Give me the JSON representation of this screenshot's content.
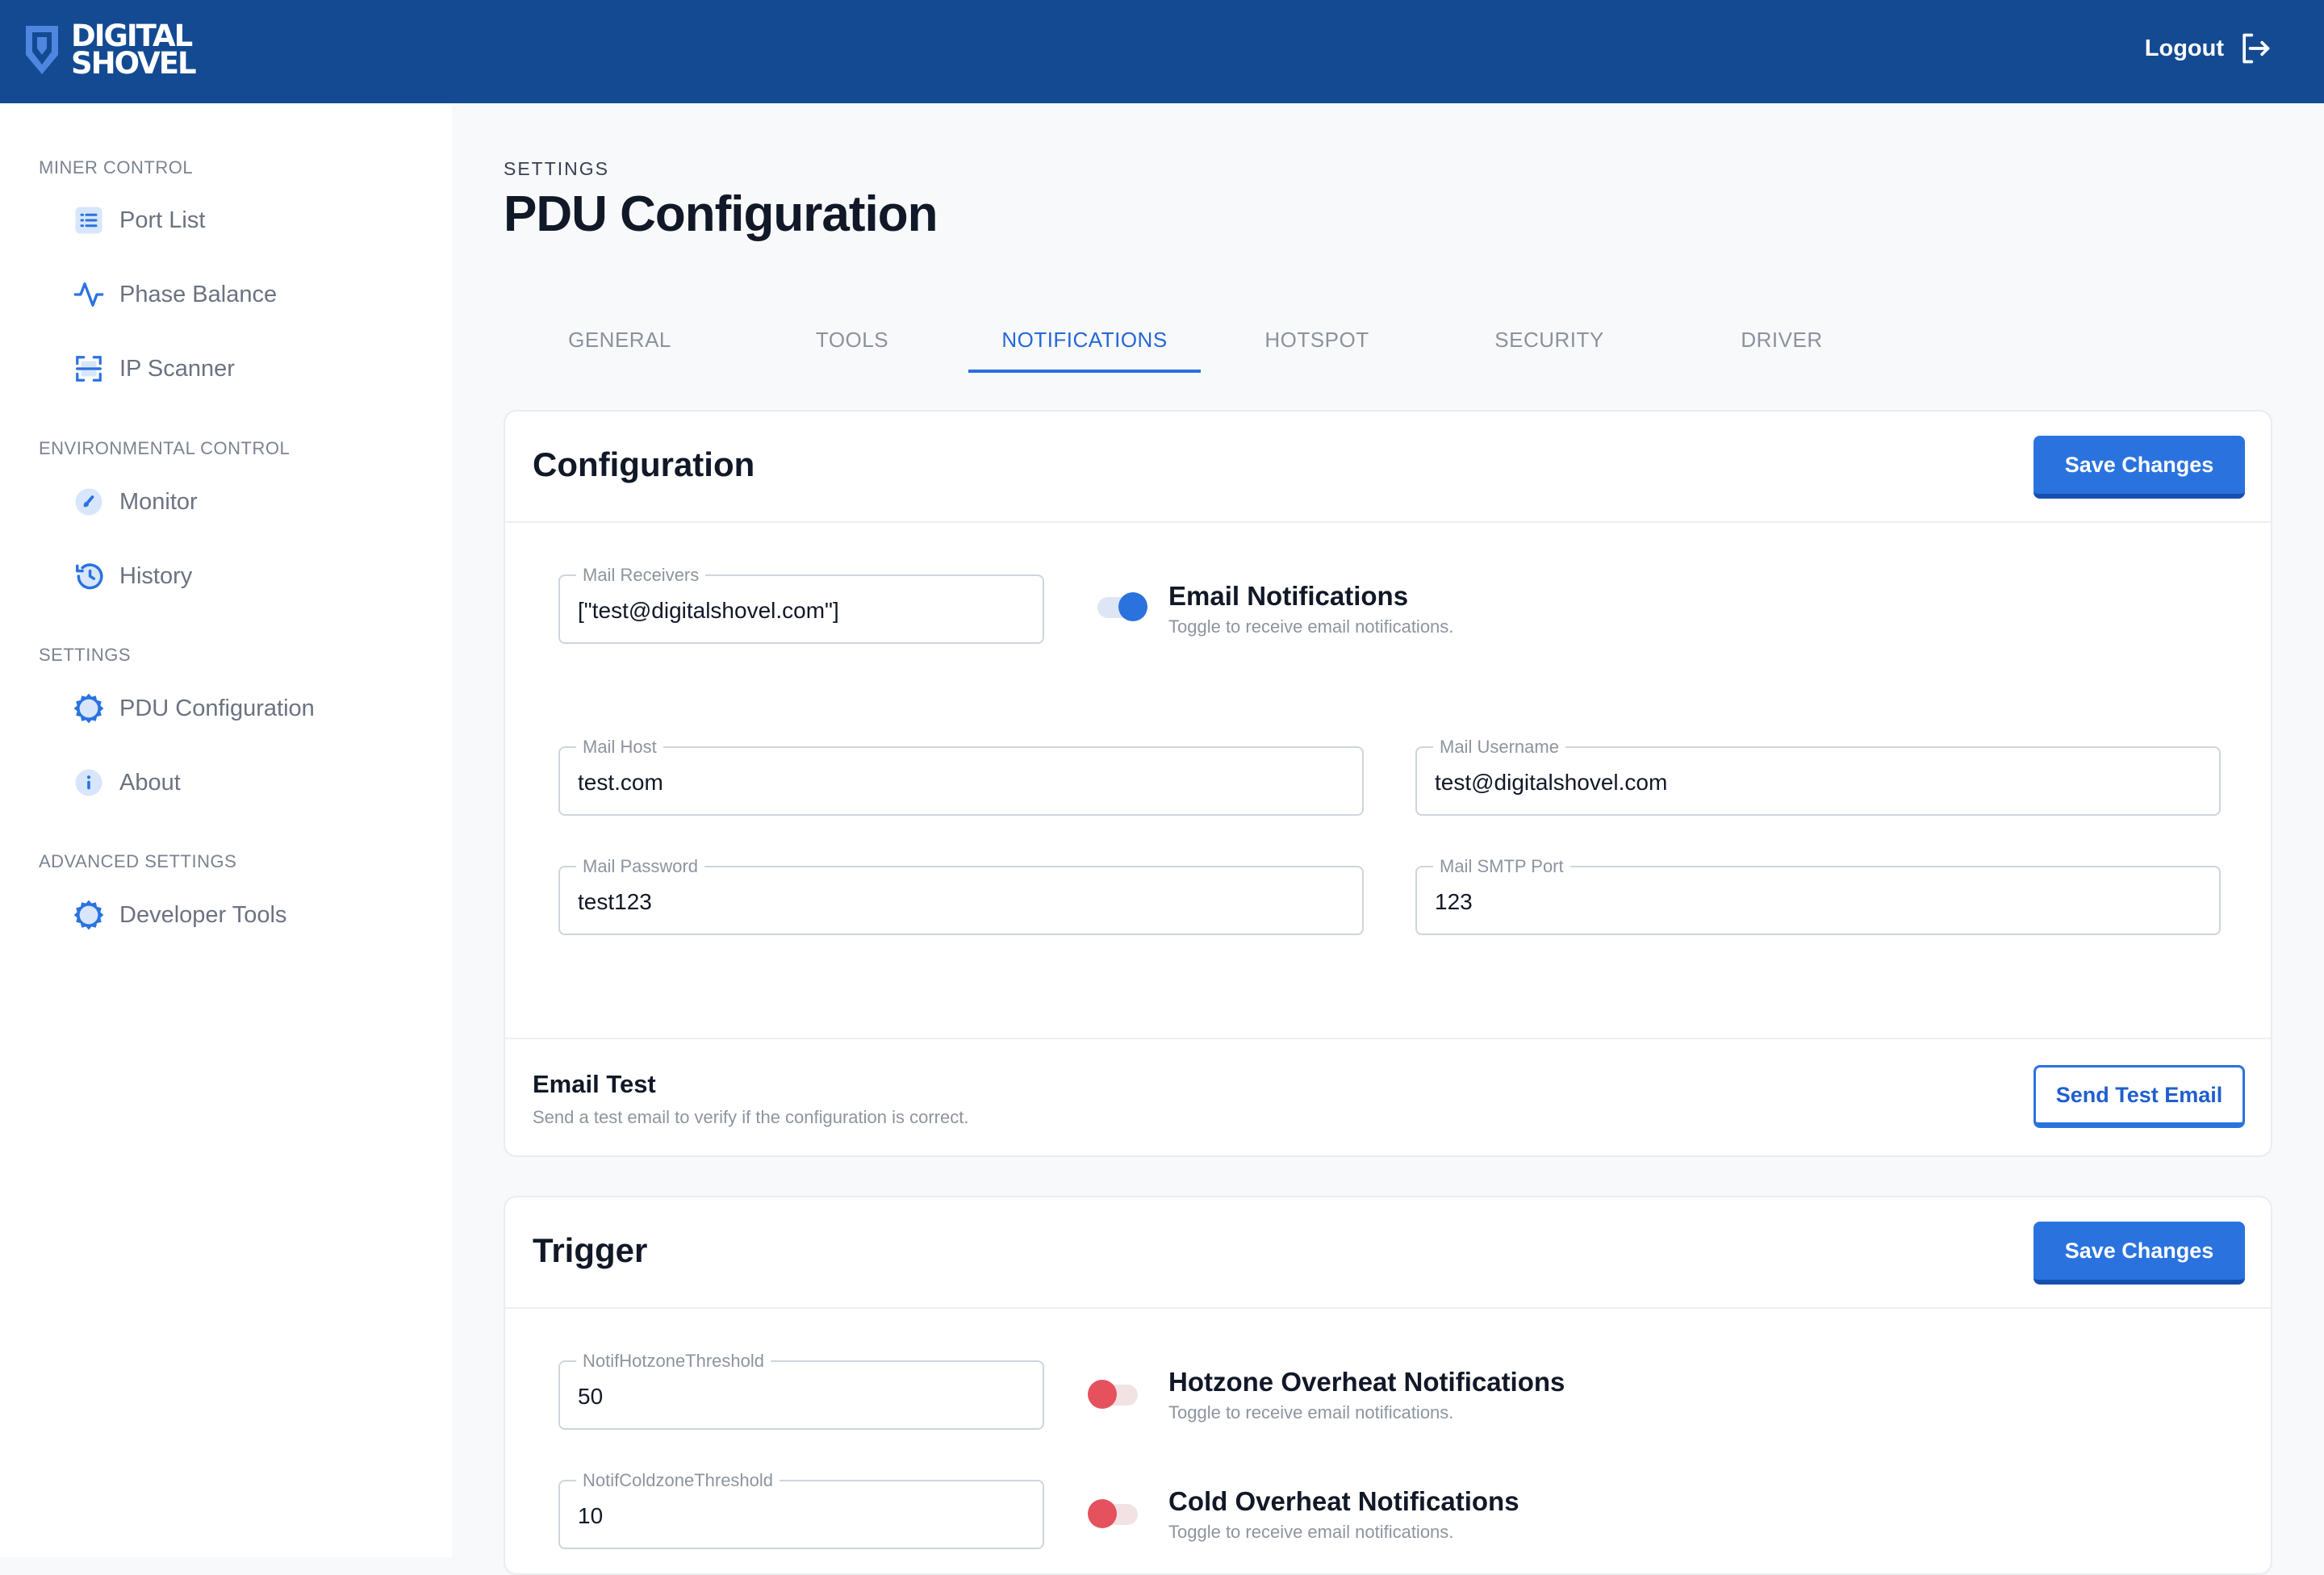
{
  "app": {
    "logo_line1": "DIGITAL",
    "logo_line2": "SHOVEL",
    "logout_label": "Logout",
    "brand_color": "#134a92",
    "accent_color": "#2a73df"
  },
  "sidebar": {
    "sections": [
      {
        "title": "MINER CONTROL",
        "items": [
          {
            "label": "Port List",
            "icon": "list-icon"
          },
          {
            "label": "Phase Balance",
            "icon": "activity-icon"
          },
          {
            "label": "IP Scanner",
            "icon": "scan-icon"
          }
        ]
      },
      {
        "title": "ENVIRONMENTAL CONTROL",
        "items": [
          {
            "label": "Monitor",
            "icon": "gauge-icon"
          },
          {
            "label": "History",
            "icon": "history-icon"
          }
        ]
      },
      {
        "title": "SETTINGS",
        "items": [
          {
            "label": "PDU Configuration",
            "icon": "gear-icon"
          },
          {
            "label": "About",
            "icon": "info-icon"
          }
        ]
      },
      {
        "title": "ADVANCED SETTINGS",
        "items": [
          {
            "label": "Developer Tools",
            "icon": "gear-icon"
          }
        ]
      }
    ]
  },
  "page": {
    "breadcrumb": "SETTINGS",
    "title": "PDU Configuration"
  },
  "tabs": [
    {
      "label": "GENERAL",
      "active": false
    },
    {
      "label": "TOOLS",
      "active": false
    },
    {
      "label": "NOTIFICATIONS",
      "active": true
    },
    {
      "label": "HOTSPOT",
      "active": false
    },
    {
      "label": "SECURITY",
      "active": false
    },
    {
      "label": "DRIVER",
      "active": false
    }
  ],
  "configuration": {
    "title": "Configuration",
    "save_label": "Save Changes",
    "mail_receivers": {
      "label": "Mail Receivers",
      "value": "[\"test@digitalshovel.com\"]"
    },
    "email_notifications": {
      "title": "Email Notifications",
      "subtitle": "Toggle to receive email notifications.",
      "enabled": true
    },
    "mail_host": {
      "label": "Mail Host",
      "value": "test.com"
    },
    "mail_username": {
      "label": "Mail Username",
      "value": "test@digitalshovel.com"
    },
    "mail_password": {
      "label": "Mail Password",
      "value": "test123"
    },
    "mail_smtp_port": {
      "label": "Mail SMTP Port",
      "value": "123"
    },
    "email_test": {
      "title": "Email Test",
      "subtitle": "Send a test email to verify if the configuration is correct.",
      "button_label": "Send Test Email"
    }
  },
  "trigger": {
    "title": "Trigger",
    "save_label": "Save Changes",
    "hotzone_threshold": {
      "label": "NotifHotzoneThreshold",
      "value": "50"
    },
    "hotzone_notifications": {
      "title": "Hotzone Overheat Notifications",
      "subtitle": "Toggle to receive email notifications.",
      "enabled": false
    },
    "coldzone_threshold": {
      "label": "NotifColdzoneThreshold",
      "value": "10"
    },
    "cold_notifications": {
      "title": "Cold Overheat Notifications",
      "subtitle": "Toggle to receive email notifications.",
      "enabled": false
    }
  }
}
